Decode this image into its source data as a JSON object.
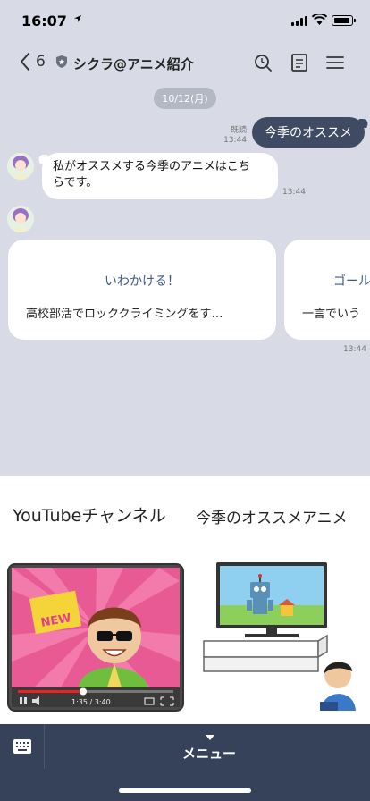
{
  "status_bar": {
    "time": "16:07",
    "icons": [
      "location-arrow-icon",
      "signal-icon",
      "wifi-icon",
      "battery-icon"
    ]
  },
  "header": {
    "back_count": "6",
    "title": "シクラ@アニメ紹介",
    "icons": [
      "search-icon",
      "notes-icon",
      "menu-icon"
    ]
  },
  "chat": {
    "date": "10/12(月)",
    "outgoing": {
      "text": "今季のオススメ",
      "read": "既読",
      "time": "13:44"
    },
    "incoming": {
      "line1": "私がオススメする今季のアニメはこち",
      "line2": "らです。",
      "time": "13:44"
    },
    "carousel": {
      "cards": [
        {
          "title": "いわかける！",
          "desc": "高校部活でロッククライミングをす…"
        },
        {
          "title": "ゴール",
          "desc": "一言でいう"
        }
      ],
      "time": "13:44"
    }
  },
  "rich_menu": {
    "items": [
      {
        "label": "YouTubeチャンネル",
        "image": "youtube-video-illustration",
        "badge": "NEW",
        "player_time": "1:35 / 3:40"
      },
      {
        "label": "今季のオススメアニメ",
        "image": "child-watching-tv-illustration"
      }
    ]
  },
  "bottom_bar": {
    "menu_label": "メニュー",
    "icons": [
      "keyboard-icon",
      "caret-down-icon"
    ]
  },
  "colors": {
    "chat_background": "#d8dbe6",
    "outgoing_bubble": "#3f4a63",
    "bottom_bar": "#36415a",
    "link_text": "#3d5a8a"
  }
}
